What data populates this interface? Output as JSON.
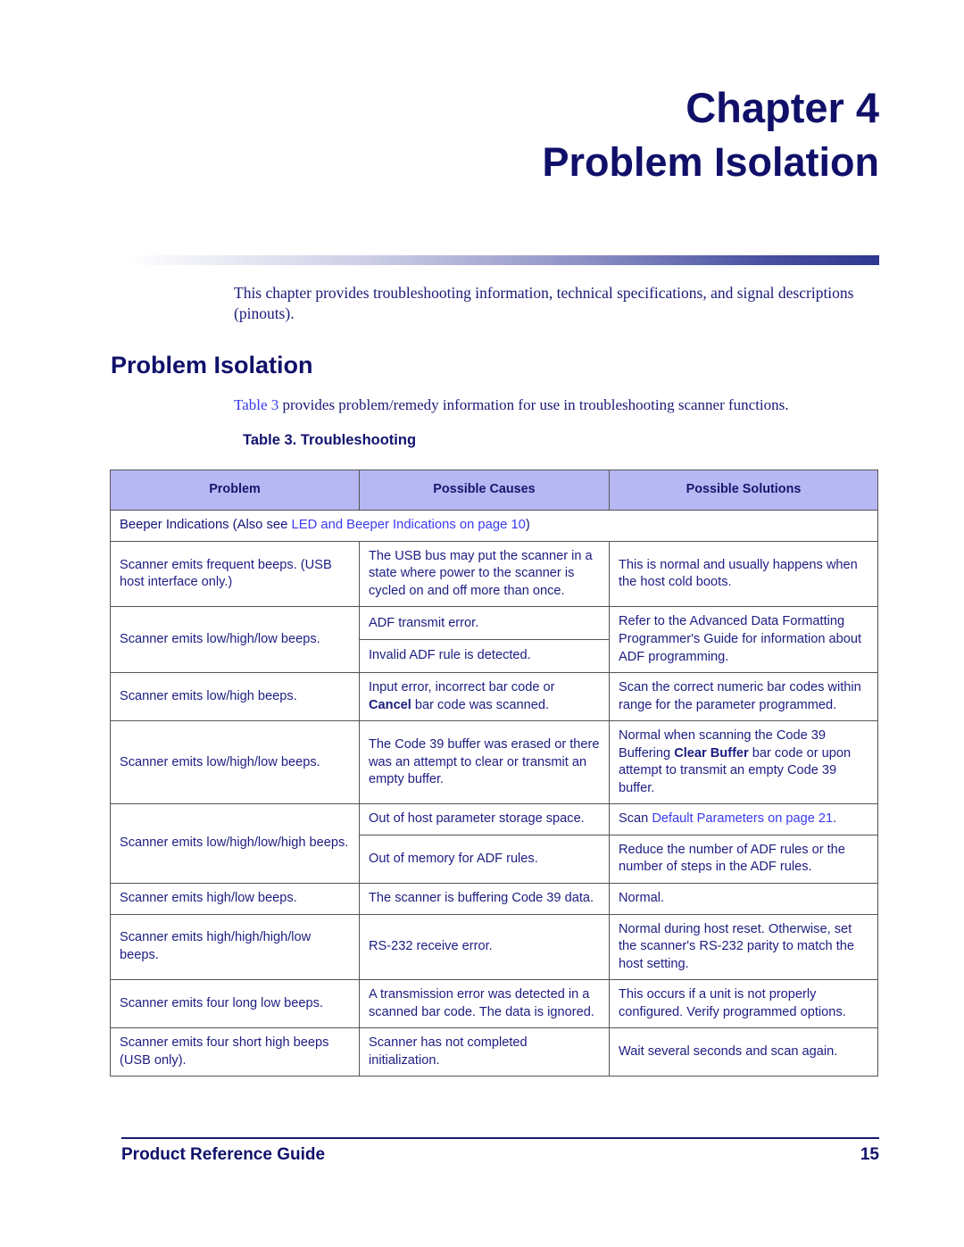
{
  "chapter": {
    "number_label": "Chapter  4",
    "title": "Problem Isolation"
  },
  "intro_paragraph": "This chapter provides troubleshooting information, technical specifications, and signal descriptions (pinouts).",
  "section": {
    "heading": "Problem Isolation",
    "intro_link": "Table 3",
    "intro_rest": " provides problem/remedy information for use in troubleshooting scanner functions.",
    "table_caption": "Table 3. Troubleshooting"
  },
  "table": {
    "headers": [
      "Problem",
      "Possible Causes",
      "Possible Solutions"
    ],
    "section_row": {
      "bold_prefix": "Beeper Indications (Also see ",
      "link": "LED and Beeper Indications on page 10",
      "bold_suffix": ")"
    },
    "rows": [
      {
        "problem": "Scanner emits frequent beeps. (USB host interface only.)",
        "causes": [
          "The USB bus may put the scanner in a state where power to the scanner is cycled on and off more than once."
        ],
        "solutions": [
          "This is normal and usually happens when the host cold boots."
        ]
      },
      {
        "problem": "Scanner emits low/high/low beeps.",
        "causes": [
          "ADF transmit error.",
          "Invalid ADF rule is detected."
        ],
        "solutions": [
          "Refer to the Advanced Data Formatting Programmer's Guide  for information about ADF programming."
        ]
      },
      {
        "problem": "Scanner emits low/high beeps.",
        "causes_pre": "Input error, incorrect bar code or ",
        "causes_bold": "Cancel",
        "causes_post": " bar code was scanned.",
        "solutions": [
          "Scan the correct numeric bar codes within range for the parameter programmed."
        ]
      },
      {
        "problem": "Scanner emits low/high/low beeps.",
        "causes": [
          "The Code 39 buffer was erased or there was an attempt to clear or transmit an empty buffer."
        ],
        "solution_pre": "Normal when scanning the Code 39 Buffering ",
        "solution_bold": "Clear Buffer",
        "solution_post": " bar code or upon attempt to transmit an empty Code 39 buffer."
      },
      {
        "problem": "Scanner emits low/high/low/high beeps.",
        "cause_a": "Out of host parameter storage space.",
        "solution_a_pre": "Scan ",
        "solution_a_link": "Default Parameters on page 21",
        "solution_a_post": ".",
        "cause_b": "Out of memory for ADF rules.",
        "solution_b": "Reduce the number of ADF rules or the number of steps in the ADF rules."
      },
      {
        "problem": "Scanner emits high/low beeps.",
        "causes": [
          "The scanner is buffering Code 39 data."
        ],
        "solutions": [
          "Normal."
        ]
      },
      {
        "problem": "Scanner emits high/high/high/low beeps.",
        "causes": [
          "RS-232 receive error."
        ],
        "solutions": [
          "Normal during host reset. Otherwise, set the scanner's RS-232 parity to match the host setting."
        ]
      },
      {
        "problem": "Scanner emits four long low beeps.",
        "causes": [
          "A transmission error was detected in a scanned bar code. The data is ignored."
        ],
        "solutions": [
          "This occurs if a unit is not properly configured. Verify  programmed options."
        ]
      },
      {
        "problem": "Scanner emits four short high beeps (USB only).",
        "causes": [
          "Scanner has not completed initialization."
        ],
        "solutions": [
          "Wait several seconds and scan again."
        ]
      }
    ]
  },
  "footer": {
    "guide_title": "Product Reference Guide",
    "page_number": "15"
  },
  "colors": {
    "navy": "#10106a",
    "body_blue": "#1a1a78",
    "link_blue": "#3a3af0",
    "header_fill": "#b7b7f4",
    "border": "#545454"
  }
}
